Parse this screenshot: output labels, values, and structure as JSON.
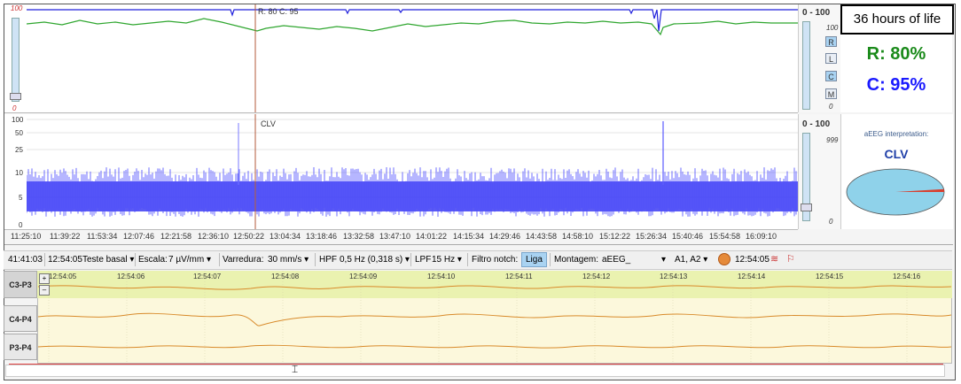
{
  "top_trace": {
    "scale_top": "100",
    "scale_bottom": "0",
    "impedance_label": "R: 80  C: 95"
  },
  "right_scale_top": {
    "range": "0 - 100",
    "max": "100",
    "min": "0"
  },
  "right_buttons": [
    "R",
    "L",
    "C",
    "M"
  ],
  "hours_label": "36 hours of life",
  "impedance": {
    "r": "R: 80%",
    "c": "C: 95%",
    "r_color": "#1a8a1a",
    "c_color": "#1a1aff"
  },
  "aeeg": {
    "y_ticks": [
      "100",
      "50",
      "25",
      "10",
      "5",
      "0"
    ],
    "pattern_label": "CLV",
    "scale": {
      "range": "0 - 100",
      "max": "999",
      "min": "0"
    },
    "interpretation_title": "aEEG interpretation:",
    "interpretation_value": "CLV",
    "pie_fraction": 0.02
  },
  "time_axis": [
    "11:25:10",
    "11:39:22",
    "11:53:34",
    "12:07:46",
    "12:21:58",
    "12:36:10",
    "12:50:22",
    "13:04:34",
    "13:18:46",
    "13:32:58",
    "13:47:10",
    "14:01:22",
    "14:15:34",
    "14:29:46",
    "14:43:58",
    "14:58:10",
    "15:12:22",
    "15:26:34",
    "15:40:46",
    "15:54:58",
    "16:09:10"
  ],
  "toolbar": {
    "elapsed": "41:41:03",
    "clock": "12:54:05",
    "test_name": "Teste basal",
    "scale_label": "Escala:",
    "scale_value": "7 µV/mm",
    "sweep_label": "Varredura:",
    "sweep_value": "30 mm/s",
    "hpf_label": "HPF",
    "hpf_value": "0,5 Hz (0,318 s)",
    "lpf_label": "LPF",
    "lpf_value": "15 Hz",
    "notch_label": "Filtro notch:",
    "notch_value": "Liga",
    "montage_label": "Montagem:",
    "montage_value": "aEEG_",
    "refs_value": "A1, A2",
    "time_right": "12:54:05"
  },
  "eeg": {
    "time_labels": [
      "12:54:05",
      "12:54:06",
      "12:54:07",
      "12:54:08",
      "12:54:09",
      "12:54:10",
      "12:54:11",
      "12:54:12",
      "12:54:13",
      "12:54:14",
      "12:54:15",
      "12:54:16"
    ],
    "channels": [
      "C3-P3",
      "C4-P4",
      "P3-P4"
    ],
    "plus": "+",
    "minus": "–"
  }
}
